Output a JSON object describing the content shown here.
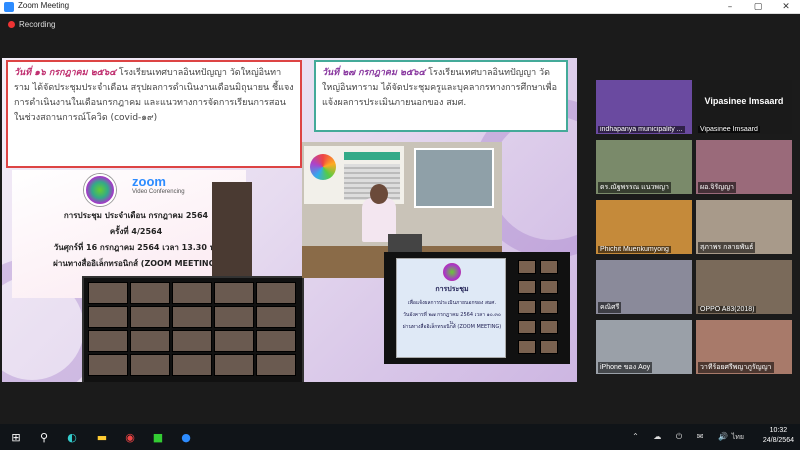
{
  "window": {
    "title": "Zoom Meeting",
    "minimize": "–",
    "maximize": "▢",
    "close": "✕"
  },
  "recording": "Recording",
  "shared": {
    "caption_left": {
      "date": "วันที่ ๑๖ กรกฎาคม ๒๕๖๔",
      "text": " โรงเรียนเทศบาลอินทปัญญา วัดใหญ่อินทาราม ได้จัดประชุมประจำเดือน สรุปผลการดำเนินงานเดือนมิถุนายน ชี้แจงการดำเนินงานในเดือนกรกฎาคม และแนวทางการจัดการเรียนการสอนในช่วงสถานการณ์โควิด (covid-๑๙)"
    },
    "caption_right": {
      "date": "วันที่ ๒๗ กรกฎาคม ๒๕๖๔",
      "text": " โรงเรียนเทศบาลอินทปัญญา วัดใหญ่อินทาราม ได้จัดประชุมครูและบุคลากรทางการศึกษาเพื่อแจ้งผลการประเมินภายนอกของ สมศ."
    },
    "left_panel": {
      "zoom_logo": "zoom",
      "zoom_sub": "Video Conferencing",
      "line1": "การประชุม ประจำเดือน กรกฎาคม 2564",
      "line2": "ครั้งที่ 4/2564",
      "line3": "วันศุกร์ที่ 16 กรกฎาคม 2564 เวลา 13.30 น.",
      "line4": "ผ่านทางสื่ออิเล็กทรอนิกส์ (ZOOM MEETING)"
    },
    "right_panel": {
      "title": "การประชุม",
      "line1": "เพื่อแจ้งผลการประเมินภายนอกของ สมศ.",
      "line2": "วันอังคารที่ ๒๗ กรกฎาคม 2564 เวลา ๑๐.๓๐ น.",
      "line3": "ผ่านทางสื่ออิเล็กทรอนิกส์ (ZOOM MEETING)"
    }
  },
  "gallery": [
    {
      "name": "indhapanya municipality ...",
      "bg": "#6a4aa0"
    },
    {
      "name": "Vipasinee Imsaard",
      "bg": "#1a1a1a",
      "big": "Vipasinee Imsaard"
    },
    {
      "name": "ดร.ณัฐพรรณ แนวพญา",
      "bg": "#7a8a6a"
    },
    {
      "name": "ผอ.จิรัญญา",
      "bg": "#9a6a7a",
      "active": true
    },
    {
      "name": "Phichit Muenkumyong",
      "bg": "#c58a3a"
    },
    {
      "name": "สุภาพร กลายพันธ์",
      "bg": "#a89a8a"
    },
    {
      "name": "คณิศรี",
      "bg": "#8a8a9a"
    },
    {
      "name": "OPPO A83(2018)",
      "bg": "#7a6a5a"
    },
    {
      "name": "iPhone ของ Aoy",
      "bg": "#9aa0a8"
    },
    {
      "name": "วาทีร้อยศรีพญาภูรัญญา",
      "bg": "#a87a6a"
    }
  ],
  "taskbar": {
    "language": "ไทย",
    "time": "10:32",
    "date": "24/8/2564",
    "tray": "⌃ ☁ ⏻ ✉ 🔊"
  }
}
